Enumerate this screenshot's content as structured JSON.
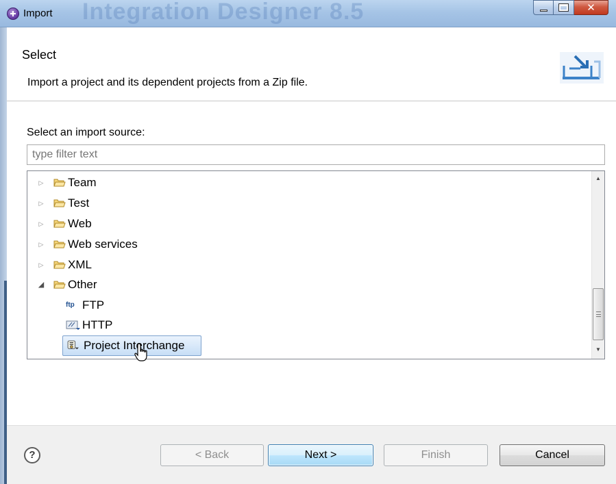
{
  "window": {
    "title": "Import",
    "background_title": "Integration Designer 8.5"
  },
  "header": {
    "title": "Select",
    "description": "Import a project and its dependent projects from a Zip file.",
    "icon": "import-wizard-icon"
  },
  "source": {
    "label": "Select an import source:",
    "filter_placeholder": "type filter text",
    "filter_value": ""
  },
  "tree": {
    "items": [
      {
        "label": "Team",
        "expanded": false,
        "icon": "folder-icon"
      },
      {
        "label": "Test",
        "expanded": false,
        "icon": "folder-icon"
      },
      {
        "label": "Web",
        "expanded": false,
        "icon": "folder-icon"
      },
      {
        "label": "Web services",
        "expanded": false,
        "icon": "folder-icon"
      },
      {
        "label": "XML",
        "expanded": false,
        "icon": "folder-icon"
      },
      {
        "label": "Other",
        "expanded": true,
        "icon": "folder-icon"
      }
    ],
    "children": [
      {
        "label": "FTP",
        "icon": "ftp-icon",
        "icon_text": "ftp"
      },
      {
        "label": "HTTP",
        "icon": "http-icon"
      },
      {
        "label": "Project Interchange",
        "icon": "project-interchange-icon",
        "selected": true
      }
    ]
  },
  "footer": {
    "help_symbol": "?",
    "back_label": "< Back",
    "next_label": "Next >",
    "finish_label": "Finish",
    "cancel_label": "Cancel"
  },
  "colors": {
    "titlebar": "#a6c4e6",
    "selection": "#c7def6",
    "selection_border": "#7da2ce",
    "default_button": "#3c7fb1",
    "close_button": "#c0391f"
  }
}
